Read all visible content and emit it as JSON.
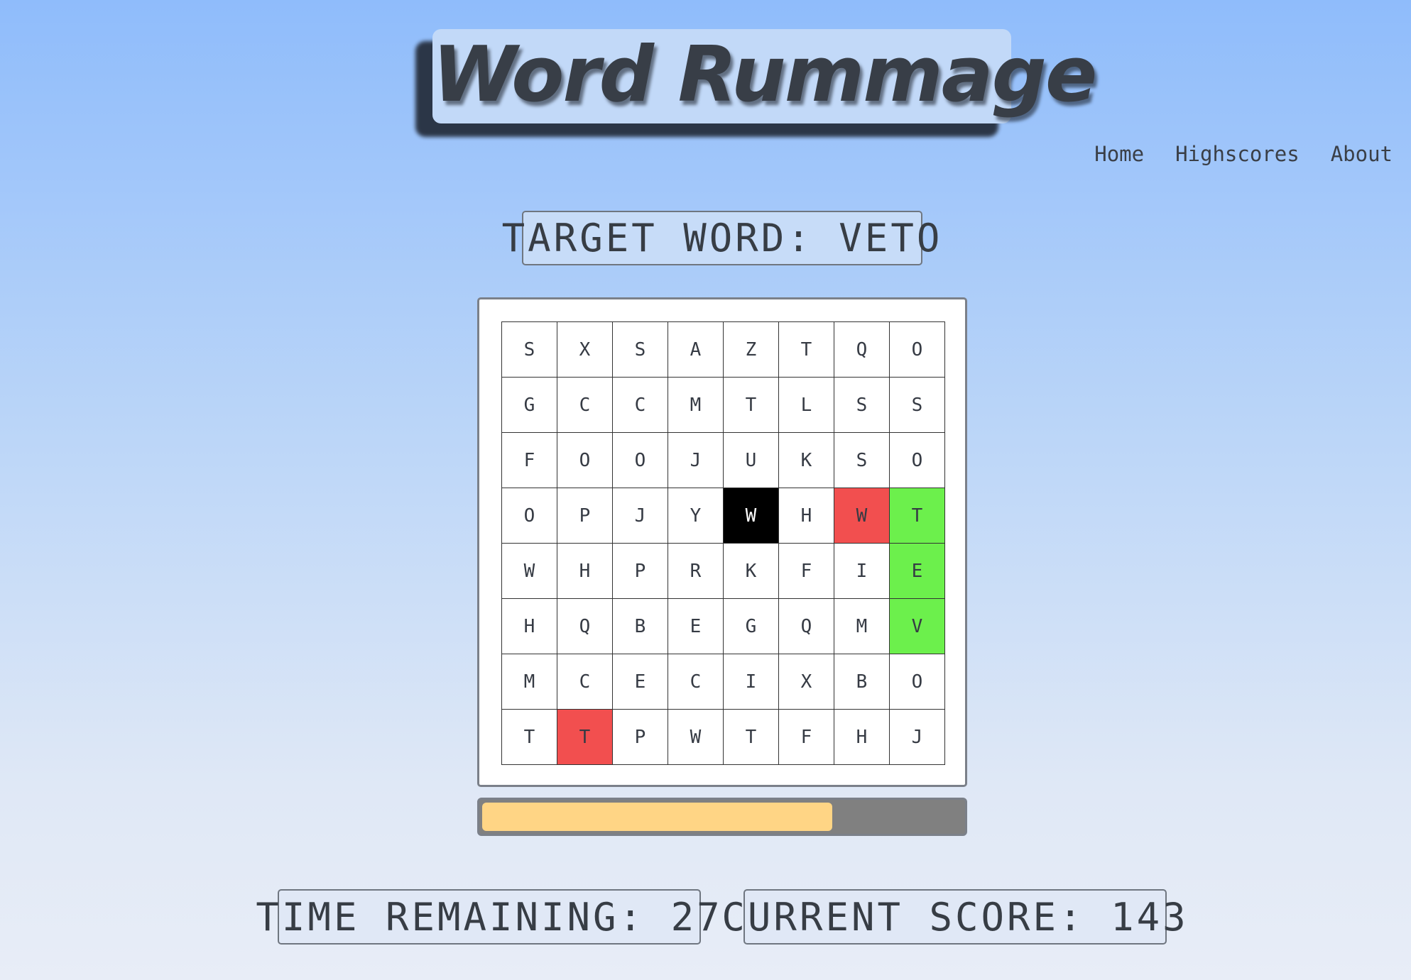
{
  "header": {
    "logo_text": "Word Rummage"
  },
  "nav": {
    "items": [
      "Home",
      "Highscores",
      "About"
    ]
  },
  "game": {
    "target_word_label": "TARGET WORD: VETO",
    "time_remaining_label": "TIME REMAINING: 27",
    "current_score_label": "CURRENT SCORE: 143",
    "progress_fraction": 0.73,
    "colors": {
      "current": "#000000",
      "wrong": "#f24f4f",
      "correct": "#6cf04c",
      "progress": "#ffd585"
    },
    "grid": [
      [
        "S",
        "X",
        "S",
        "A",
        "Z",
        "T",
        "Q",
        "O"
      ],
      [
        "G",
        "C",
        "C",
        "M",
        "T",
        "L",
        "S",
        "S"
      ],
      [
        "F",
        "O",
        "O",
        "J",
        "U",
        "K",
        "S",
        "O"
      ],
      [
        "O",
        "P",
        "J",
        "Y",
        "W",
        "H",
        "W",
        "T"
      ],
      [
        "W",
        "H",
        "P",
        "R",
        "K",
        "F",
        "I",
        "E"
      ],
      [
        "H",
        "Q",
        "B",
        "E",
        "G",
        "Q",
        "M",
        "V"
      ],
      [
        "M",
        "C",
        "E",
        "C",
        "I",
        "X",
        "B",
        "O"
      ],
      [
        "T",
        "T",
        "P",
        "W",
        "T",
        "F",
        "H",
        "J"
      ]
    ],
    "cell_states": [
      [
        "",
        "",
        "",
        "",
        "",
        "",
        "",
        ""
      ],
      [
        "",
        "",
        "",
        "",
        "",
        "",
        "",
        ""
      ],
      [
        "",
        "",
        "",
        "",
        "",
        "",
        "",
        ""
      ],
      [
        "",
        "",
        "",
        "",
        "current",
        "",
        "wrong",
        "correct"
      ],
      [
        "",
        "",
        "",
        "",
        "",
        "",
        "",
        "correct"
      ],
      [
        "",
        "",
        "",
        "",
        "",
        "",
        "",
        "correct"
      ],
      [
        "",
        "",
        "",
        "",
        "",
        "",
        "",
        ""
      ],
      [
        "",
        "wrong",
        "",
        "",
        "",
        "",
        "",
        ""
      ]
    ]
  }
}
